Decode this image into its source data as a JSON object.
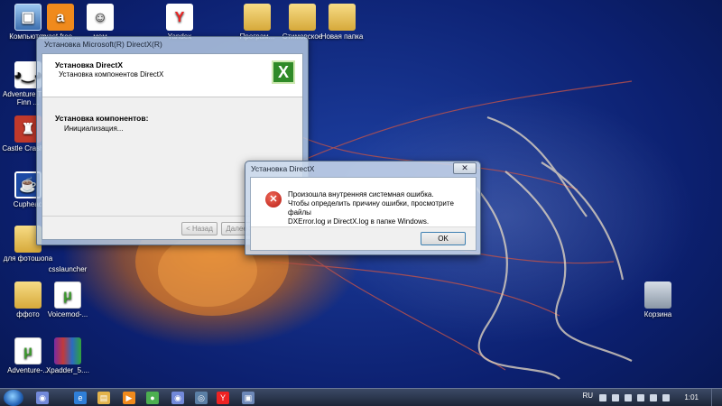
{
  "desktop": {
    "icons": [
      {
        "label": "Компьютер",
        "glyph": "▣",
        "kind": "pc"
      },
      {
        "label": "avast free ...",
        "glyph": "a",
        "kind": "avast"
      },
      {
        "label": "мем",
        "glyph": "☺",
        "kind": "mem"
      },
      {
        "label": "Yandex",
        "glyph": "Y",
        "kind": "yandex"
      },
      {
        "label": "Програм...",
        "glyph": "",
        "kind": "folder"
      },
      {
        "label": "Стимовское",
        "glyph": "",
        "kind": "folder"
      },
      {
        "label": "Новая папка",
        "glyph": "",
        "kind": "folder"
      },
      {
        "label": "Adventure Time Finn ...",
        "glyph": "◕‿◕",
        "kind": "finn"
      },
      {
        "label": "Castle Crashers",
        "glyph": "♜",
        "kind": "castle"
      },
      {
        "label": "Cuphead",
        "glyph": "☕",
        "kind": "cup"
      },
      {
        "label": "для фотошопа",
        "glyph": "",
        "kind": "folder"
      },
      {
        "label": "csslauncher",
        "glyph": "",
        "kind": "none"
      },
      {
        "label": "ффото",
        "glyph": "",
        "kind": "folder"
      },
      {
        "label": "Voicemod-...",
        "glyph": "μ",
        "kind": "torrent"
      },
      {
        "label": "Adventure-...",
        "glyph": "μ",
        "kind": "torrent"
      },
      {
        "label": "Xpadder_5....",
        "glyph": "",
        "kind": "rar"
      },
      {
        "label": "Корзина",
        "glyph": "",
        "kind": "trash"
      }
    ]
  },
  "installer": {
    "window_title": "Установка Microsoft(R) DirectX(R)",
    "header_title": "Установка DirectX",
    "header_subtitle": "Установка компонентов DirectX",
    "logo_glyph": "X",
    "status_label": "Установка компонентов:",
    "status_value": "Инициализация...",
    "back_button": "< Назад",
    "next_button": "Далее >"
  },
  "error_dialog": {
    "title": "Установка DirectX",
    "close_glyph": "✕",
    "icon_glyph": "✕",
    "message_line1": "Произошла внутренняя системная ошибка.",
    "message_line2": "Чтобы определить причину ошибки, просмотрите файлы",
    "message_line3": "DXError.log и DirectX.log в папке Windows.",
    "ok_button": "OK"
  },
  "taskbar": {
    "buttons": [
      {
        "icon": "discord-icon",
        "glyph": "◉",
        "color": "#7289da"
      },
      {
        "icon": "ie-icon",
        "glyph": "e",
        "color": "#2f7fd8"
      },
      {
        "icon": "explorer-icon",
        "glyph": "▤",
        "color": "#e3b34b"
      },
      {
        "icon": "media-icon",
        "glyph": "▶",
        "color": "#f08a1c"
      },
      {
        "icon": "chrome-icon",
        "glyph": "●",
        "color": "#4caf50"
      },
      {
        "icon": "discord2-icon",
        "glyph": "◉",
        "color": "#7289da"
      },
      {
        "icon": "steam-icon",
        "glyph": "◎",
        "color": "#5b7fa6"
      },
      {
        "icon": "yandex-icon",
        "glyph": "Y",
        "color": "#e22"
      },
      {
        "icon": "directx-setup-icon",
        "glyph": "▣",
        "color": "#6d88b8"
      }
    ],
    "language": "RU",
    "clock": "1:01"
  }
}
